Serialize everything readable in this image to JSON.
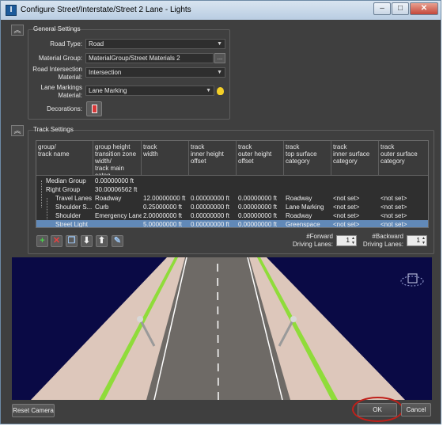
{
  "window": {
    "title": "Configure Street/Interstate/Street 2 Lane - Lights",
    "minimize_glyph": "–",
    "maximize_glyph": "□",
    "close_glyph": "✕",
    "app_icon_glyph": "I"
  },
  "general": {
    "title": "General Settings",
    "road_type_label": "Road Type:",
    "road_type_value": "Road",
    "material_group_label": "Material Group:",
    "material_group_value": "MaterialGroup/Street Materials 2",
    "browse_label": "...",
    "intersection_label": "Road Intersection\nMaterial:",
    "intersection_value": "Intersection",
    "lane_markings_label": "Lane Markings\nMaterial:",
    "lane_markings_value": "Lane Marking",
    "decorations_label": "Decorations:"
  },
  "track": {
    "title": "Track Settings",
    "headers": [
      "group/\ntrack name",
      "group height\ntransition zone\nwidth/\ntrack main categ",
      "track\nwidth",
      "track\ninner height\noffset",
      "track\nouter height\noffset",
      "track\ntop surface\ncategory",
      "track\ninner surface\ncategory",
      "track\nouter surface\ncategory"
    ],
    "rows": [
      {
        "name": "Median Group",
        "c1": "0.00000000 ft",
        "c2": "",
        "c3": "",
        "c4": "",
        "c5": "",
        "c6": "",
        "c7": ""
      },
      {
        "name": "Right Group",
        "c1": "30.00006562 ft",
        "c2": "",
        "c3": "",
        "c4": "",
        "c5": "",
        "c6": "",
        "c7": ""
      },
      {
        "name": "Travel Lanes",
        "c1": "Roadway",
        "c2": "12.00000000 ft",
        "c3": "0.00000000 ft",
        "c4": "0.00000000 ft",
        "c5": "Roadway",
        "c6": "<not set>",
        "c7": "<not set>"
      },
      {
        "name": "Shoulder S...",
        "c1": "Curb",
        "c2": "0.25000000 ft",
        "c3": "0.00000000 ft",
        "c4": "0.00000000 ft",
        "c5": "Lane Marking",
        "c6": "<not set>",
        "c7": "<not set>"
      },
      {
        "name": "Shoulder",
        "c1": "Emergency Lane",
        "c2": "2.00000000 ft",
        "c3": "0.00000000 ft",
        "c4": "0.00000000 ft",
        "c5": "Roadway",
        "c6": "<not set>",
        "c7": "<not set>"
      },
      {
        "name": "Street Light",
        "c1": "",
        "c2": "5.00000000 ft",
        "c3": "0.00000000 ft",
        "c4": "0.00000000 ft",
        "c5": "Greenspace",
        "c6": "<not set>",
        "c7": "<not set>"
      }
    ],
    "forward_label": "#Forward\nDriving Lanes:",
    "forward_value": "1",
    "backward_label": "#Backward\nDriving Lanes:",
    "backward_value": "1",
    "toolbar": {
      "add_glyph": "+",
      "delete_glyph": "✕",
      "copy_glyph": "❐",
      "down_glyph": "⬇",
      "up_glyph": "⬆",
      "edit_glyph": "✎"
    }
  },
  "footer": {
    "reset_camera": "Reset Camera",
    "ok": "OK",
    "cancel": "Cancel"
  },
  "colors": {
    "window_bg": "#3f3f3f",
    "selection": "#6189b8",
    "sky": "#0a0a45",
    "sidewalk": "#ddc7bb",
    "grass": "#8fdc3a",
    "road": "#6e6a66",
    "highlight_ring": "#c0201a"
  }
}
